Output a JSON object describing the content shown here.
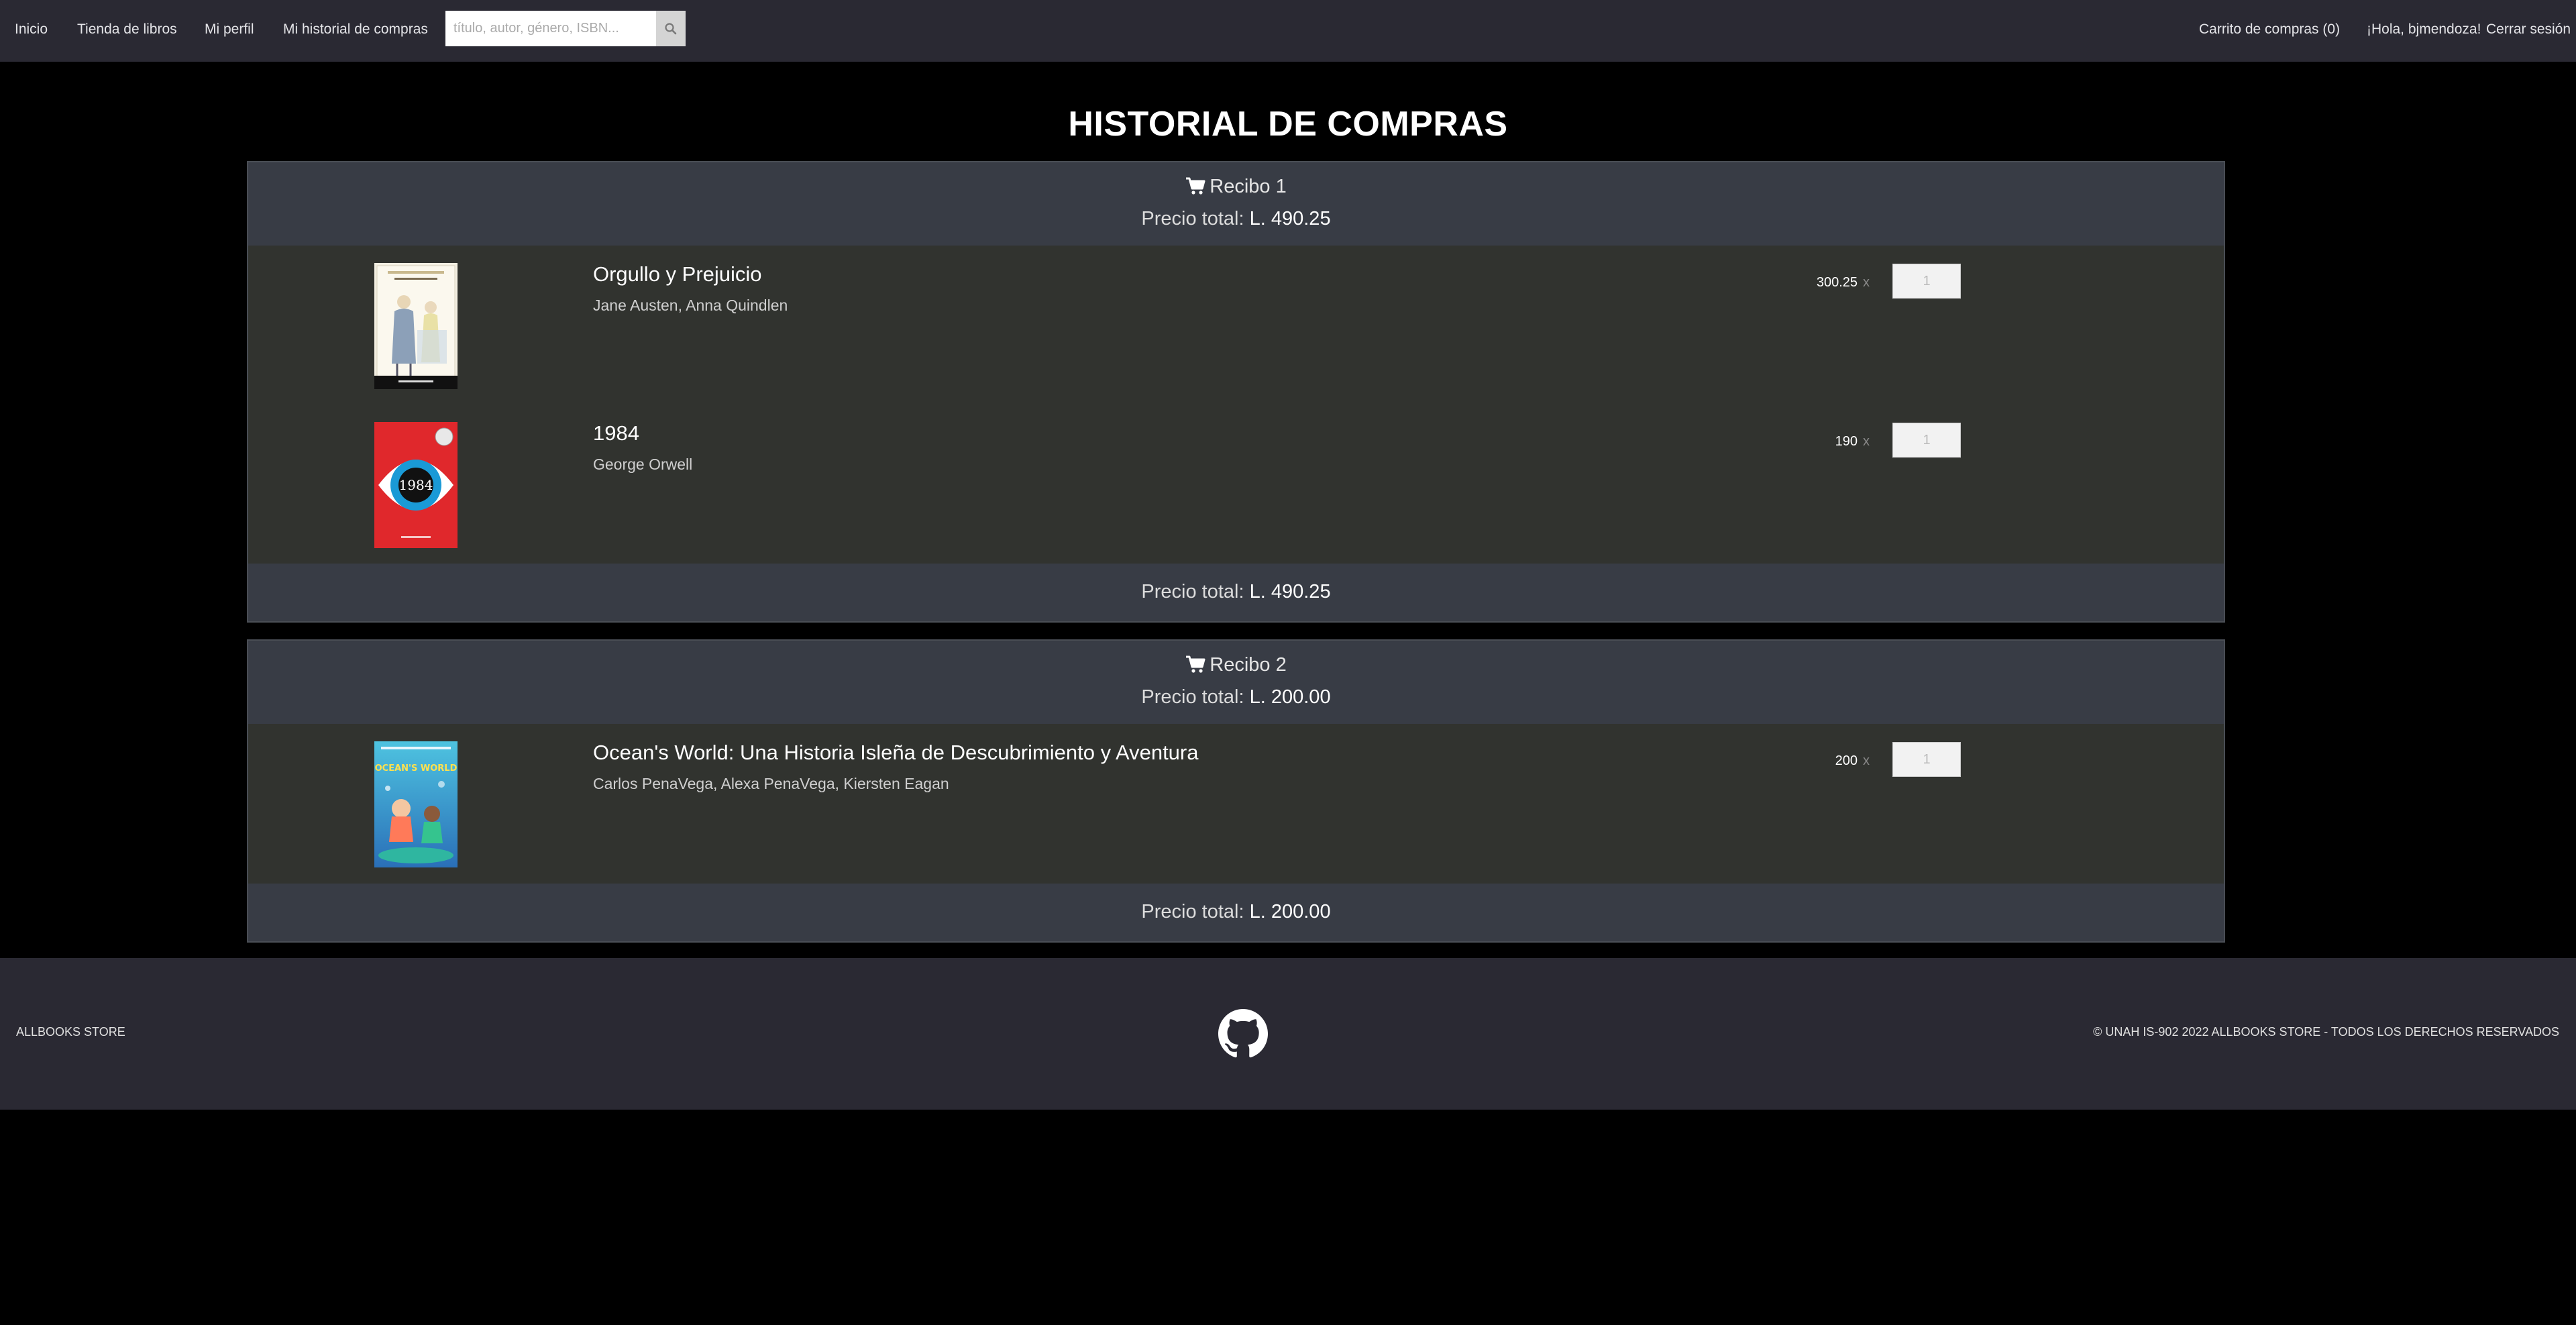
{
  "nav": {
    "links": [
      "Inicio",
      "Tienda de libros",
      "Mi perfil",
      "Mi historial de compras"
    ],
    "search_placeholder": "título, autor, género, ISBN...",
    "search_icon": "search-icon",
    "cart_label": "Carrito de compras (0)",
    "greeting": "¡Hola, bjmendoza!",
    "logout": "Cerrar sesión"
  },
  "page_title": "HISTORIAL DE COMPRAS",
  "total_label": "Precio total:",
  "receipts": [
    {
      "title": "Recibo 1",
      "total": "L. 490.25",
      "items": [
        {
          "title": "Orgullo y Prejuicio",
          "authors": "Jane Austen, Anna Quindlen",
          "price": "300.25",
          "qty": "1",
          "cover_text": "PRIDE AND PREJUDICE"
        },
        {
          "title": "1984",
          "authors": "George Orwell",
          "price": "190",
          "qty": "1",
          "cover_text": "1984"
        }
      ]
    },
    {
      "title": "Recibo 2",
      "total": "L. 200.00",
      "items": [
        {
          "title": "Ocean's World: Una Historia Isleña de Descubrimiento y Aventura",
          "authors": "Carlos PenaVega, Alexa PenaVega, Kiersten Eagan",
          "price": "200",
          "qty": "1",
          "cover_text": "OCEAN'S WORLD"
        }
      ]
    }
  ],
  "times_symbol": "x",
  "footer": {
    "brand": "ALLBOOKS STORE",
    "copyright": "© UNAH IS-902 2022 ALLBOOKS STORE - TODOS LOS DERECHOS RESERVADOS",
    "icon": "github-icon"
  },
  "colors": {
    "nav_bg": "#2a2933",
    "page_bg": "#000000",
    "receipt_header_bg": "#383c45",
    "receipt_body_bg": "#31332f"
  }
}
